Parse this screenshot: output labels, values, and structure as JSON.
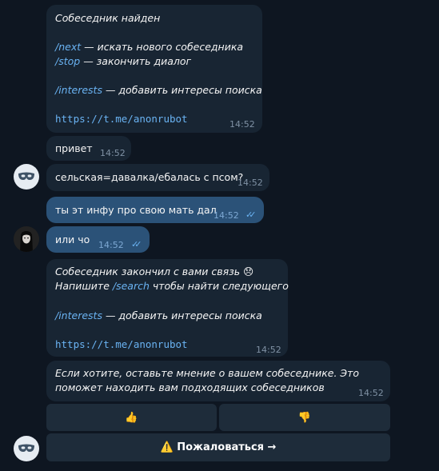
{
  "messages": {
    "m1": {
      "title": "Собеседник найден",
      "next_cmd": "/next",
      "next_text": " — искать нового собеседника",
      "stop_cmd": "/stop",
      "stop_text": " — закончить диалог",
      "interests_cmd": "/interests",
      "interests_text": " — добавить интересы поиска",
      "link": "https://t.me/anonrubot",
      "time": "14:52"
    },
    "m2": {
      "text": "привет",
      "time": "14:52"
    },
    "m3": {
      "text": "сельская=давалка/ебалась с псом?",
      "time": "14:52"
    },
    "m4": {
      "text": "ты эт инфу про свою мать дал",
      "time": "14:52"
    },
    "m5": {
      "text": "или чо",
      "time": "14:52"
    },
    "m6": {
      "line1": "Собеседник закончил с вами связь",
      "emoji": "😞",
      "line2_pre": "Напишите ",
      "search_cmd": "/search",
      "line2_post": " чтобы найти следующего",
      "interests_cmd": "/interests",
      "interests_text": " — добавить интересы поиска",
      "link": "https://t.me/anonrubot",
      "time": "14:52"
    },
    "m7": {
      "line1": "Если хотите, оставьте мнение о вашем собеседнике. Это",
      "line2": "поможет находить вам подходящих собеседников",
      "time": "14:52"
    }
  },
  "keyboard": {
    "thumbs_up": "👍",
    "thumbs_down": "👎",
    "report": "⚠️ Пожаловаться →"
  },
  "colors": {
    "background": "#0e1621",
    "incoming": "#182533",
    "outgoing": "#2b5278",
    "link": "#6ab3f3"
  }
}
